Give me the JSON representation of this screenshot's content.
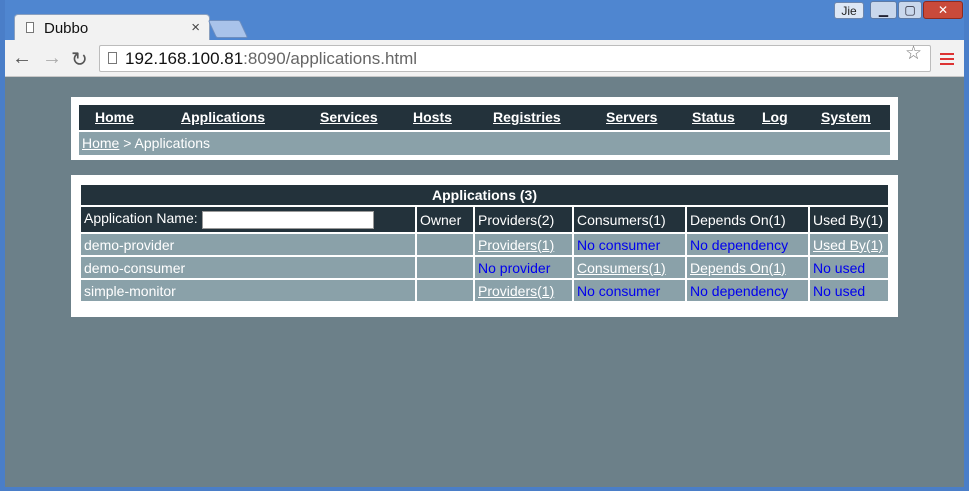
{
  "browser": {
    "tab_title": "Dubbo",
    "tab_close": "×",
    "user_name": "Jie",
    "url_host": "192.168.100.81",
    "url_rest": ":8090/applications.html"
  },
  "menu": {
    "items": [
      "Home",
      "Applications",
      "Services",
      "Hosts",
      "Registries",
      "Servers",
      "Status",
      "Log",
      "System"
    ]
  },
  "breadcrumb": {
    "home": "Home",
    "separator": " > ",
    "current": "Applications"
  },
  "table": {
    "caption": "Applications (3)",
    "headers": {
      "app_name": "Application Name:",
      "owner": "Owner",
      "providers": "Providers(2)",
      "consumers": "Consumers(1)",
      "depends_on": "Depends On(1)",
      "used_by": "Used By(1)"
    },
    "search_value": "",
    "rows": [
      {
        "name": "demo-provider",
        "owner": "",
        "providers": "Providers(1)",
        "consumers": "No consumer",
        "depends": "No dependency",
        "used_by": "Used By(1)"
      },
      {
        "name": "demo-consumer",
        "owner": "",
        "providers": "No provider",
        "consumers": "Consumers(1)",
        "depends": "Depends On(1)",
        "used_by": "No used"
      },
      {
        "name": "simple-monitor",
        "owner": "",
        "providers": "Providers(1)",
        "consumers": "No consumer",
        "depends": "No dependency",
        "used_by": "No used"
      }
    ]
  },
  "colors": {
    "dark": "#23323b",
    "row": "#8aa1a9",
    "background": "#6c8089",
    "link_blue": "#0000ee"
  }
}
